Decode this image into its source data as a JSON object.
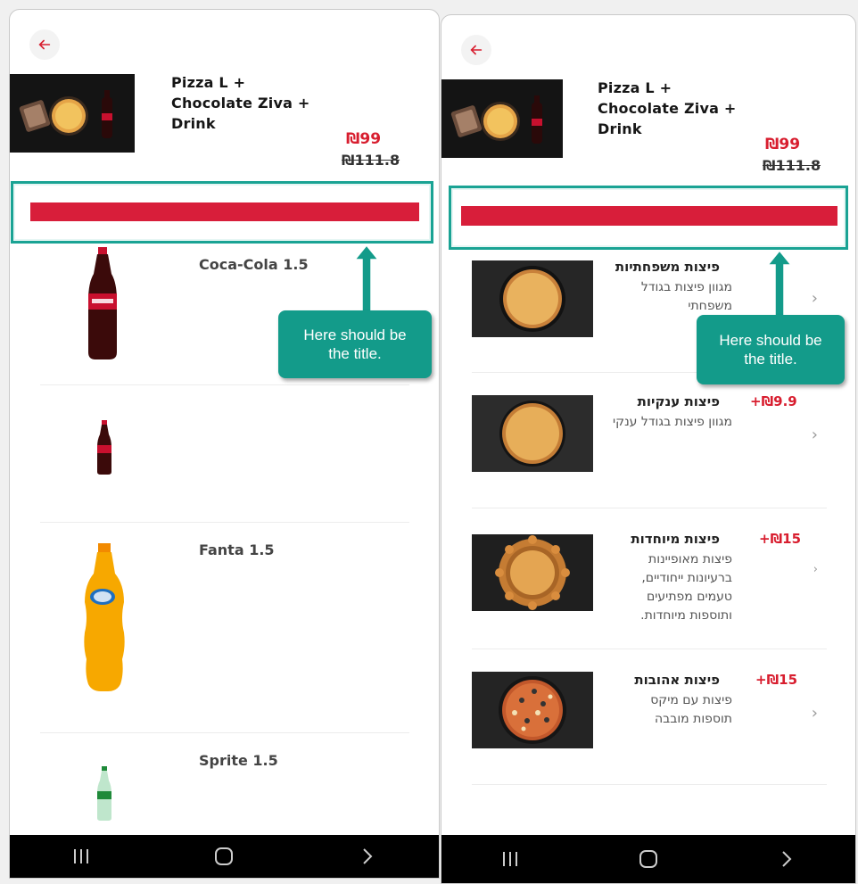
{
  "product": {
    "title_lines": [
      "Pizza L +",
      "Chocolate Ziva +",
      "Drink"
    ],
    "price_now": "₪99",
    "price_old": "₪111.8"
  },
  "callout": {
    "line1": "Here should be",
    "line2": "the title."
  },
  "drinks": [
    {
      "name": "Coca-Cola 1.5"
    },
    {
      "name": ""
    },
    {
      "name": "Fanta 1.5"
    },
    {
      "name": "Sprite 1.5"
    }
  ],
  "pizzas": [
    {
      "name": "פיצות משפחתיות",
      "desc": "מגוון פיצות בגודל משפחתי",
      "price": ""
    },
    {
      "name": "פיצות ענקיות",
      "desc": "מגוון פיצות בגודל ענקי",
      "price": "+₪9.9"
    },
    {
      "name": "פיצות מיוחדות",
      "desc": "פיצות מאופיינות ברעיונות ייחודיים, טעמים מפתיעים ותוספות מיוחדות.",
      "price": "+₪15"
    },
    {
      "name": "פיצות אהובות",
      "desc": "פיצות עם מיקס תוספות מובבה",
      "price": "+₪15"
    }
  ],
  "icons": {
    "back": "arrow-left-icon",
    "recent": "recent-apps-icon",
    "home": "home-icon",
    "nav_back": "chevron-right-icon"
  },
  "colors": {
    "brand_red": "#d81e2f",
    "callout_teal": "#139b8a",
    "box_border": "#1aa394"
  }
}
